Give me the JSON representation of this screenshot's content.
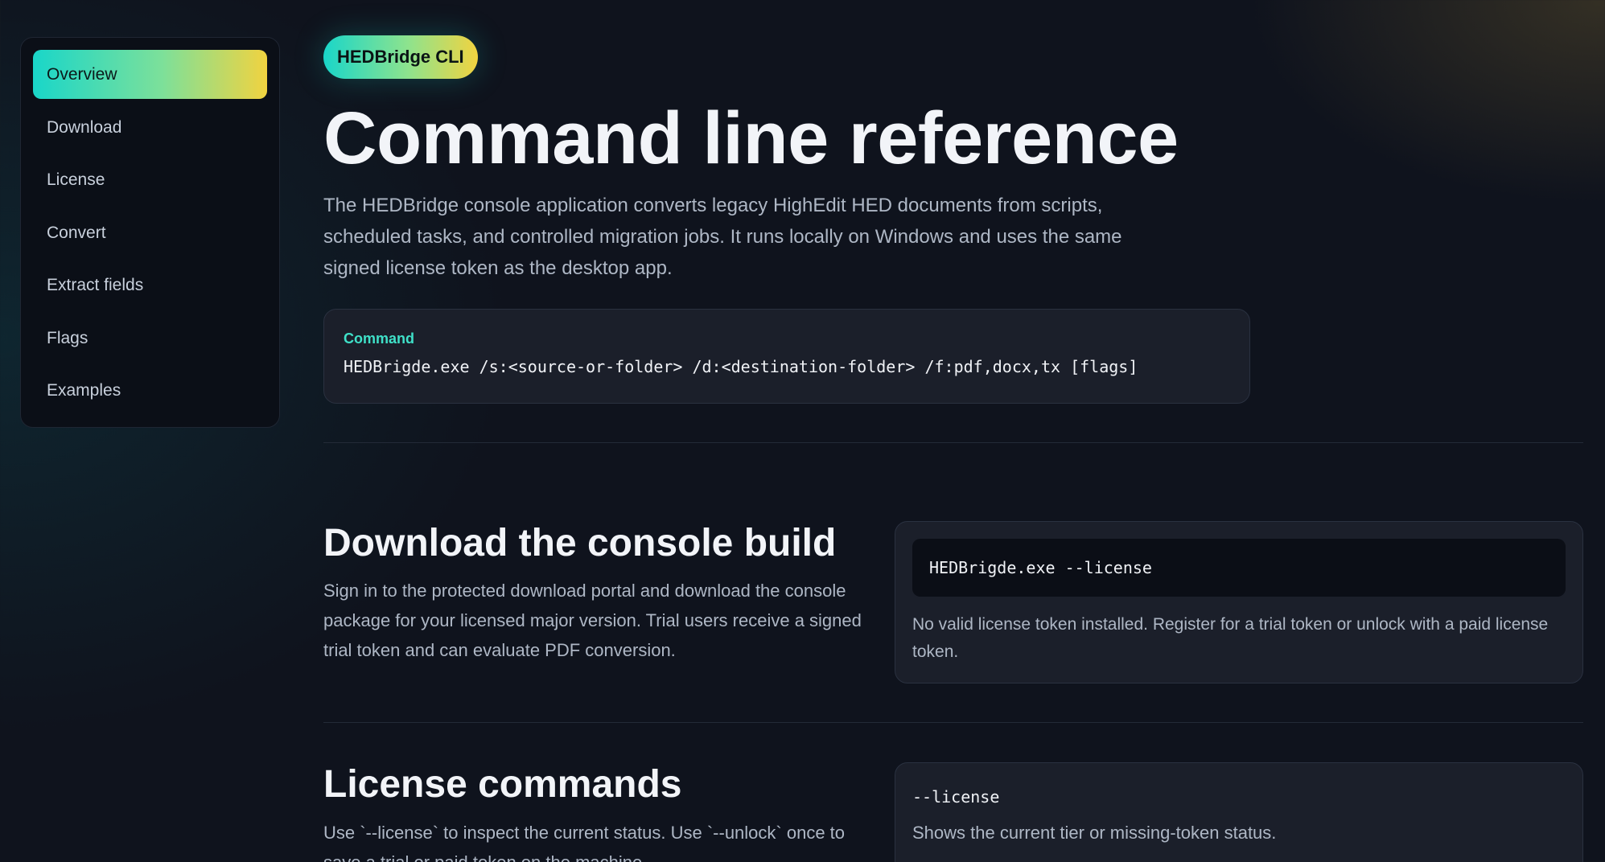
{
  "sidebar": {
    "items": [
      {
        "label": "Overview",
        "active": true
      },
      {
        "label": "Download"
      },
      {
        "label": "License"
      },
      {
        "label": "Convert"
      },
      {
        "label": "Extract fields"
      },
      {
        "label": "Flags"
      },
      {
        "label": "Examples"
      }
    ]
  },
  "hero": {
    "badge": "HEDBridge CLI",
    "title": "Command line reference",
    "intro": "The HEDBridge console application converts legacy HighEdit HED documents from scripts, scheduled tasks, and controlled migration jobs. It runs locally on Windows and uses the same signed license token as the desktop app.",
    "command_label": "Command",
    "command": "HEDBrigde.exe /s:<source-or-folder> /d:<destination-folder> /f:pdf,docx,tx [flags]"
  },
  "download": {
    "title": "Download the console build",
    "text": "Sign in to the protected download portal and download the console package for your licensed major version. Trial users receive a signed trial token and can evaluate PDF conversion.",
    "terminal_command": "HEDBrigde.exe --license",
    "terminal_output": "No valid license token installed. Register for a trial token or unlock with a paid license token."
  },
  "license": {
    "title": "License commands",
    "text": "Use `--license` to inspect the current status. Use `--unlock` once to save a trial or paid token on the machine.",
    "flag_name": "--license",
    "flag_desc": "Shows the current tier or missing-token status."
  },
  "colors": {
    "accent_start": "#19d6c9",
    "accent_end": "#f1d340",
    "command_label": "#3fe0c8",
    "background": "#0f131d"
  }
}
